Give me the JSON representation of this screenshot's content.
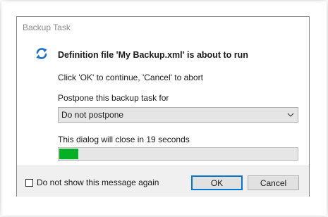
{
  "window": {
    "title": "Backup Task"
  },
  "message": {
    "icon": "refresh-arrows-icon",
    "heading": "Definition file 'My Backup.xml' is about to run",
    "instruction": "Click 'OK' to continue, 'Cancel' to abort"
  },
  "postpone": {
    "label": "Postpone this backup task for",
    "selected": "Do not postpone"
  },
  "countdown": {
    "text": "This dialog will close in 19 seconds",
    "progress_fraction": 0.08
  },
  "footer": {
    "checkbox_label": "Do not show this message again",
    "checkbox_checked": false,
    "ok_label": "OK",
    "cancel_label": "Cancel"
  },
  "colors": {
    "accent": "#0078d7",
    "progress": "#06b025",
    "icon": "#1e73c8"
  }
}
